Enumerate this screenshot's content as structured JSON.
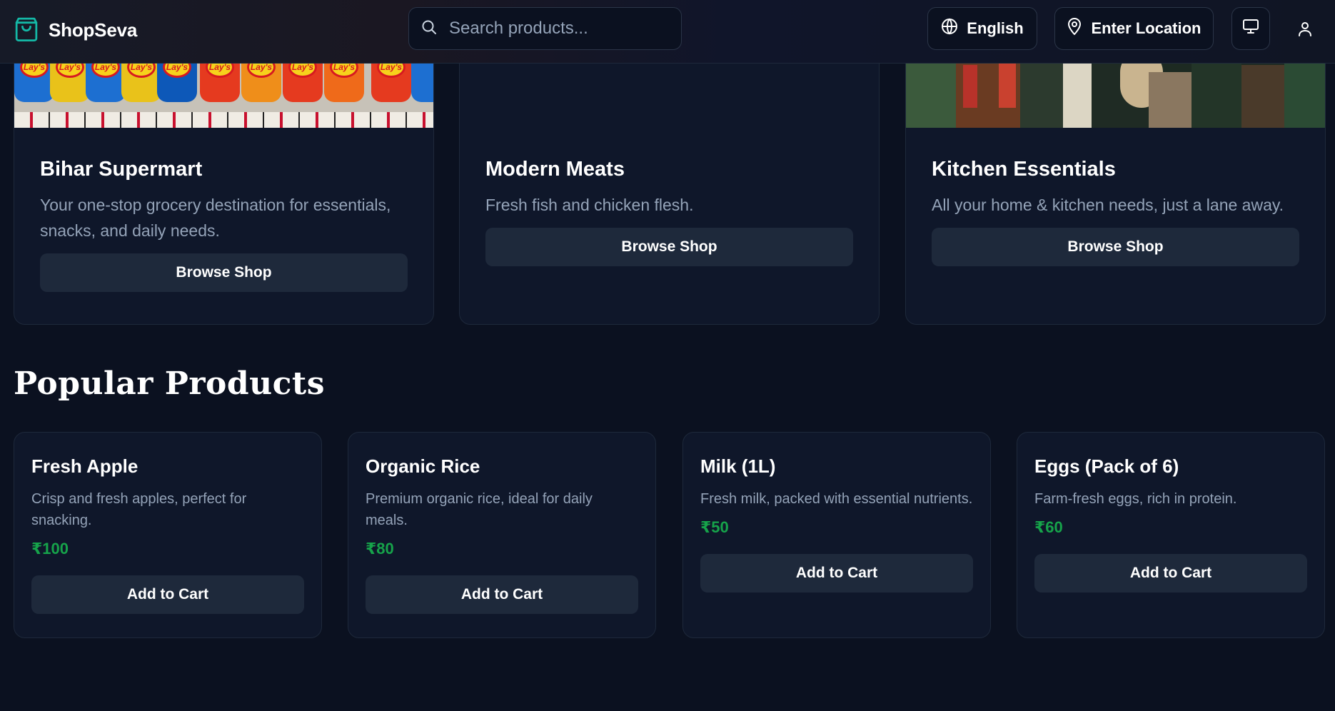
{
  "header": {
    "brand": "ShopSeva",
    "search_placeholder": "Search products...",
    "language": "English",
    "location": "Enter Location",
    "icons": {
      "brand": "shopping-bag-icon",
      "search": "search-icon",
      "language": "globe-icon",
      "location": "map-pin-icon",
      "monitor": "monitor-icon",
      "user": "user-icon"
    }
  },
  "shops": [
    {
      "name": "Bihar Supermart",
      "description": "Your one-stop grocery destination for essentials, snacks, and daily needs.",
      "button": "Browse Shop"
    },
    {
      "name": "Modern Meats",
      "description": "Fresh fish and chicken flesh.",
      "button": "Browse Shop"
    },
    {
      "name": "Kitchen Essentials",
      "description": "All your home & kitchen needs, just a lane away.",
      "button": "Browse Shop"
    }
  ],
  "chips_logo": "Lay's",
  "popular": {
    "title": "Popular Products",
    "products": [
      {
        "name": "Fresh Apple",
        "description": "Crisp and fresh apples, perfect for snacking.",
        "price": "₹100",
        "button": "Add to Cart"
      },
      {
        "name": "Organic Rice",
        "description": "Premium organic rice, ideal for daily meals.",
        "price": "₹80",
        "button": "Add to Cart"
      },
      {
        "name": "Milk (1L)",
        "description": "Fresh milk, packed with essential nutrients.",
        "price": "₹50",
        "button": "Add to Cart"
      },
      {
        "name": "Eggs (Pack of 6)",
        "description": "Farm-fresh eggs, rich in protein.",
        "price": "₹60",
        "button": "Add to Cart"
      }
    ]
  },
  "colors": {
    "background": "#0b1120",
    "card": "#0f172a",
    "button": "#1e293b",
    "price": "#16a34a",
    "brand_icon": "#14b8a6",
    "muted_text": "#94a3b8"
  }
}
